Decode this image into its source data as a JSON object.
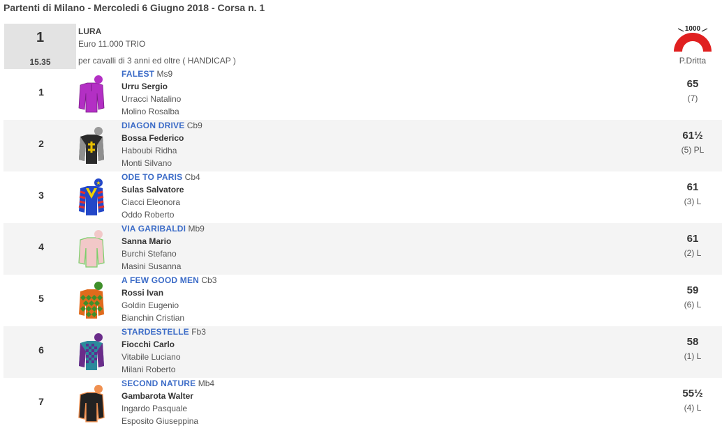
{
  "page_title": "Partenti di Milano - Mercoledi 6 Giugno 2018 - Corsa n. 1",
  "race": {
    "number": "1",
    "time": "15.35",
    "name": "LURA",
    "prize": "Euro 11.000 TRIO",
    "conditions": "per cavalli di 3 anni ed oltre ( HANDICAP )",
    "track_badge": "1000",
    "track": "P.Dritta"
  },
  "runners": [
    {
      "num": "1",
      "horse": "FALEST",
      "info": "Ms9",
      "jockey": "Urru Sergio",
      "trainer": "Urracci Natalino",
      "owner": "Molino Rosalba",
      "weight": "65",
      "draw": "(7)",
      "silk_icon": "purple-silk-icon"
    },
    {
      "num": "2",
      "horse": "DIAGON DRIVE",
      "info": "Cb9",
      "jockey": "Bossa Federico",
      "trainer": "Haboubi Ridha",
      "owner": "Monti Silvano",
      "weight": "61½",
      "draw": "(5) PL",
      "silk_icon": "black-grey-silk-icon"
    },
    {
      "num": "3",
      "horse": "ODE TO PARIS",
      "info": "Cb4",
      "jockey": "Sulas Salvatore",
      "trainer": "Ciacci Eleonora",
      "owner": "Oddo Roberto",
      "weight": "61",
      "draw": "(3) L",
      "silk_icon": "blue-yellow-silk-icon"
    },
    {
      "num": "4",
      "horse": "VIA GARIBALDI",
      "info": "Mb9",
      "jockey": "Sanna Mario",
      "trainer": "Burchi Stefano",
      "owner": "Masini Susanna",
      "weight": "61",
      "draw": "(2) L",
      "silk_icon": "pink-green-silk-icon"
    },
    {
      "num": "5",
      "horse": "A FEW GOOD MEN",
      "info": "Cb3",
      "jockey": "Rossi Ivan",
      "trainer": "Goldin Eugenio",
      "owner": "Bianchin Cristian",
      "weight": "59",
      "draw": "(6) L",
      "silk_icon": "green-orange-silk-icon"
    },
    {
      "num": "6",
      "horse": "STARDESTELLE",
      "info": "Fb3",
      "jockey": "Fiocchi Carlo",
      "trainer": "Vitabile Luciano",
      "owner": "Milani Roberto",
      "weight": "58",
      "draw": "(1) L",
      "silk_icon": "teal-purple-silk-icon"
    },
    {
      "num": "7",
      "horse": "SECOND NATURE",
      "info": "Mb4",
      "jockey": "Gambarota Walter",
      "trainer": "Ingardo Pasquale",
      "owner": "Esposito Giuseppina",
      "weight": "55½",
      "draw": "(4) L",
      "silk_icon": "black-orange-silk-icon"
    }
  ],
  "colors": {
    "horse_link": "#3b6bc7",
    "alt_row": "#f4f4f4",
    "race_box": "#e3e3e3",
    "track_arc": "#e02020"
  }
}
